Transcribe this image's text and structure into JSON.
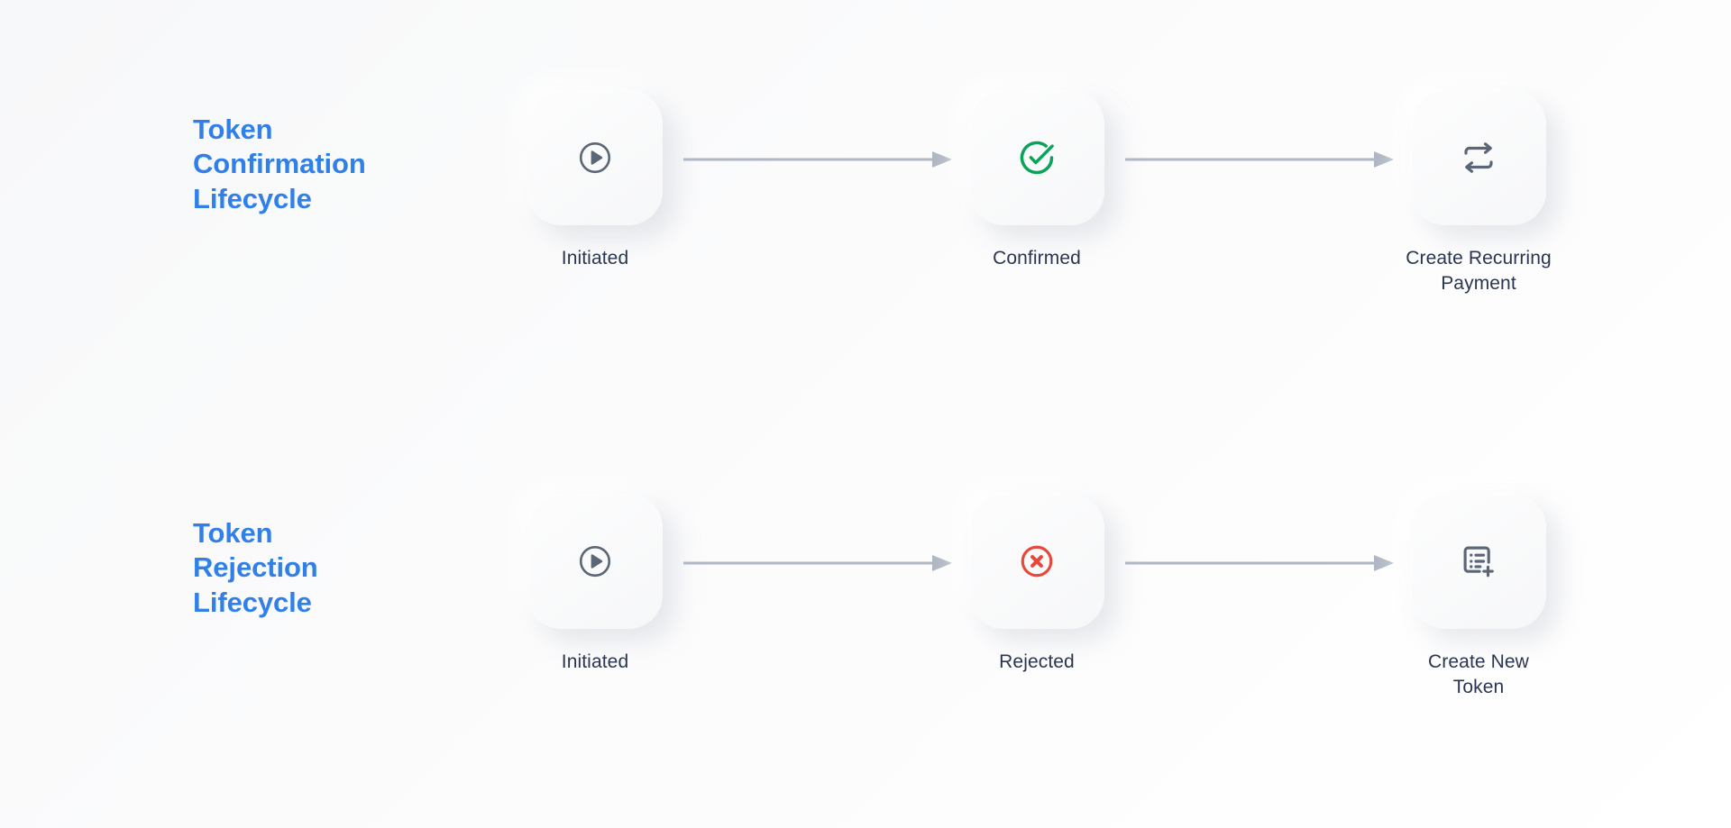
{
  "diagram": {
    "background_color": "#fafbfc",
    "accent_color": "#3180e8",
    "label_color": "#2a3650",
    "arrow_color": "#b0b7c3",
    "success_color": "#0aa35a",
    "error_color": "#e8483c",
    "icon_color": "#5b6676",
    "rows": [
      {
        "id": "token-confirmation-lifecycle",
        "title_lines": [
          "Token",
          "Confirmation",
          "Lifecycle"
        ],
        "stages": [
          {
            "id": "initiated",
            "icon": "play-circle-icon",
            "caption_lines": [
              "Initiated"
            ]
          },
          {
            "id": "confirmed",
            "icon": "check-circle-icon",
            "caption_lines": [
              "Confirmed"
            ]
          },
          {
            "id": "create-recurring-payment",
            "icon": "repeat-arrows-icon",
            "caption_lines": [
              "Create Recurring",
              "Payment"
            ]
          }
        ],
        "arrows": [
          {
            "id": "arrow-initiated-to-confirmed",
            "direction": "right"
          },
          {
            "id": "arrow-confirmed-to-recurring",
            "direction": "right"
          }
        ]
      },
      {
        "id": "token-rejection-lifecycle",
        "title_lines": [
          "Token",
          "Rejection",
          "Lifecycle"
        ],
        "stages": [
          {
            "id": "initiated",
            "icon": "play-circle-icon",
            "caption_lines": [
              "Initiated"
            ]
          },
          {
            "id": "rejected",
            "icon": "x-circle-icon",
            "caption_lines": [
              "Rejected"
            ]
          },
          {
            "id": "create-new-token",
            "icon": "list-plus-icon",
            "caption_lines": [
              "Create New",
              "Token"
            ]
          }
        ],
        "arrows": [
          {
            "id": "arrow-initiated-to-rejected",
            "direction": "right"
          },
          {
            "id": "arrow-rejected-to-new-token",
            "direction": "right"
          }
        ]
      }
    ]
  }
}
